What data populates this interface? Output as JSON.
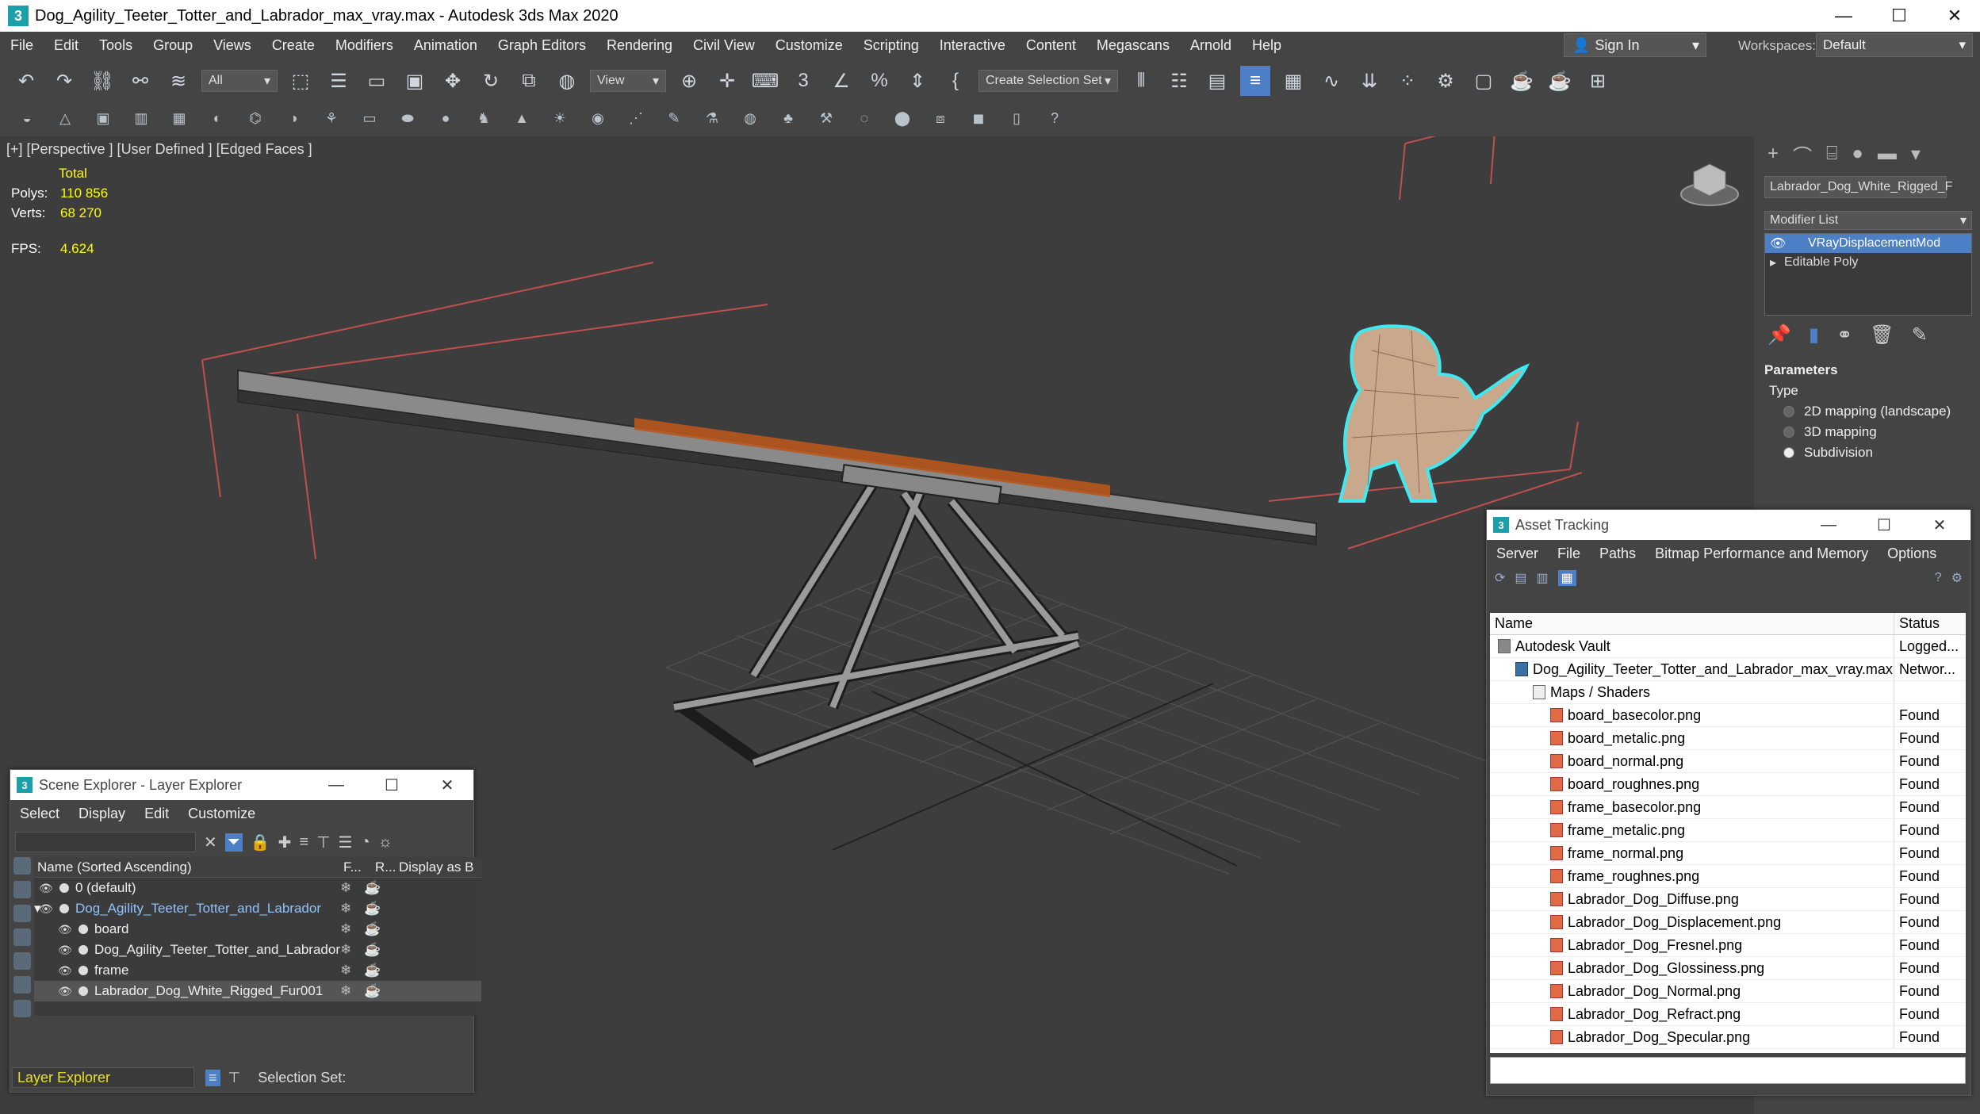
{
  "window": {
    "title": "Dog_Agility_Teeter_Totter_and_Labrador_max_vray.max - Autodesk 3ds Max 2020",
    "app_icon": "3"
  },
  "menu": [
    "File",
    "Edit",
    "Tools",
    "Group",
    "Views",
    "Create",
    "Modifiers",
    "Animation",
    "Graph Editors",
    "Rendering",
    "Civil View",
    "Customize",
    "Scripting",
    "Interactive",
    "Content",
    "Megascans",
    "Arnold",
    "Help"
  ],
  "account": {
    "sign_in": "Sign In",
    "workspaces_label": "Workspaces:",
    "workspace": "Default"
  },
  "toolbar": {
    "filter": "All",
    "ref_coord": "View",
    "selection_set": "Create Selection Set"
  },
  "viewport": {
    "label": "[+] [Perspective ] [User Defined ] [Edged Faces ]",
    "total": "Total",
    "polys_label": "Polys:",
    "polys": "110 856",
    "verts_label": "Verts:",
    "verts": "68 270",
    "fps_label": "FPS:",
    "fps": "4.624"
  },
  "command_panel": {
    "object_name": "Labrador_Dog_White_Rigged_F",
    "modifier_list": "Modifier List",
    "stack": [
      "VRayDisplacementMod",
      "Editable Poly"
    ],
    "params_header": "Parameters",
    "type_label": "Type",
    "options": [
      "2D mapping (landscape)",
      "3D mapping",
      "Subdivision"
    ],
    "selected_option": "Subdivision"
  },
  "asset_tracking": {
    "title": "Asset Tracking",
    "menu": [
      "Server",
      "File",
      "Paths",
      "Bitmap Performance and Memory",
      "Options"
    ],
    "columns": {
      "name": "Name",
      "status": "Status"
    },
    "rows": [
      {
        "name": "Autodesk Vault",
        "status": "Logged...",
        "indent": 0,
        "icon": "vault"
      },
      {
        "name": "Dog_Agility_Teeter_Totter_and_Labrador_max_vray.max",
        "status": "Networ...",
        "indent": 1,
        "icon": "max"
      },
      {
        "name": "Maps / Shaders",
        "status": "",
        "indent": 2,
        "icon": "folder"
      },
      {
        "name": "board_basecolor.png",
        "status": "Found",
        "indent": 3,
        "icon": "img"
      },
      {
        "name": "board_metalic.png",
        "status": "Found",
        "indent": 3,
        "icon": "img"
      },
      {
        "name": "board_normal.png",
        "status": "Found",
        "indent": 3,
        "icon": "img"
      },
      {
        "name": "board_roughnes.png",
        "status": "Found",
        "indent": 3,
        "icon": "img"
      },
      {
        "name": "frame_basecolor.png",
        "status": "Found",
        "indent": 3,
        "icon": "img"
      },
      {
        "name": "frame_metalic.png",
        "status": "Found",
        "indent": 3,
        "icon": "img"
      },
      {
        "name": "frame_normal.png",
        "status": "Found",
        "indent": 3,
        "icon": "img"
      },
      {
        "name": "frame_roughnes.png",
        "status": "Found",
        "indent": 3,
        "icon": "img"
      },
      {
        "name": "Labrador_Dog_Diffuse.png",
        "status": "Found",
        "indent": 3,
        "icon": "img"
      },
      {
        "name": "Labrador_Dog_Displacement.png",
        "status": "Found",
        "indent": 3,
        "icon": "img"
      },
      {
        "name": "Labrador_Dog_Fresnel.png",
        "status": "Found",
        "indent": 3,
        "icon": "img"
      },
      {
        "name": "Labrador_Dog_Glossiness.png",
        "status": "Found",
        "indent": 3,
        "icon": "img"
      },
      {
        "name": "Labrador_Dog_Normal.png",
        "status": "Found",
        "indent": 3,
        "icon": "img"
      },
      {
        "name": "Labrador_Dog_Refract.png",
        "status": "Found",
        "indent": 3,
        "icon": "img"
      },
      {
        "name": "Labrador_Dog_Specular.png",
        "status": "Found",
        "indent": 3,
        "icon": "img"
      }
    ]
  },
  "scene_explorer": {
    "title": "Scene Explorer - Layer Explorer",
    "menu": [
      "Select",
      "Display",
      "Edit",
      "Customize"
    ],
    "columns": {
      "name": "Name (Sorted Ascending)",
      "f": "F...",
      "r": "R...",
      "display": "Display as B"
    },
    "rows": [
      {
        "name": "0 (default)",
        "indent": 0
      },
      {
        "name": "Dog_Agility_Teeter_Totter_and_Labrador",
        "indent": 0
      },
      {
        "name": "board",
        "indent": 1
      },
      {
        "name": "Dog_Agility_Teeter_Totter_and_Labrador",
        "indent": 1
      },
      {
        "name": "frame",
        "indent": 1
      },
      {
        "name": "Labrador_Dog_White_Rigged_Fur001",
        "indent": 1
      }
    ],
    "footer": {
      "mode": "Layer Explorer",
      "selection_set": "Selection Set:"
    }
  },
  "colors": {
    "accent": "#4d7fc6",
    "board_orange": "#b8561d",
    "selection_red": "#c0504d",
    "stat_yellow": "#ffff00"
  }
}
